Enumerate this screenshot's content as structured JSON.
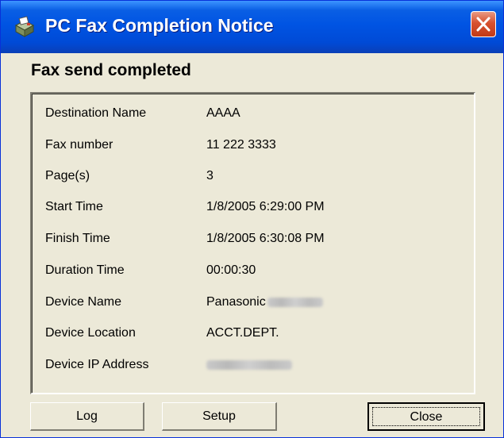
{
  "window": {
    "title": "PC Fax Completion Notice",
    "icon": "fax-app-icon",
    "close_icon": "close-icon"
  },
  "header": "Fax send completed",
  "details": [
    {
      "label": "Destination Name",
      "value": "AAAA"
    },
    {
      "label": "Fax number",
      "value": "11 222 3333"
    },
    {
      "label": "Page(s)",
      "value": "3"
    },
    {
      "label": "Start Time",
      "value": "1/8/2005 6:29:00 PM"
    },
    {
      "label": "Finish Time",
      "value": "1/8/2005 6:30:08 PM"
    },
    {
      "label": "Duration Time",
      "value": "00:00:30"
    },
    {
      "label": "Device Name",
      "value": "Panasonic"
    },
    {
      "label": "Device Location",
      "value": "ACCT.DEPT."
    },
    {
      "label": "Device IP Address",
      "value": ""
    }
  ],
  "buttons": {
    "log": "Log",
    "setup": "Setup",
    "close": "Close"
  },
  "colors": {
    "titlebar": "#0054e3",
    "window_bg": "#ece9d8",
    "close_button": "#d7512f"
  }
}
